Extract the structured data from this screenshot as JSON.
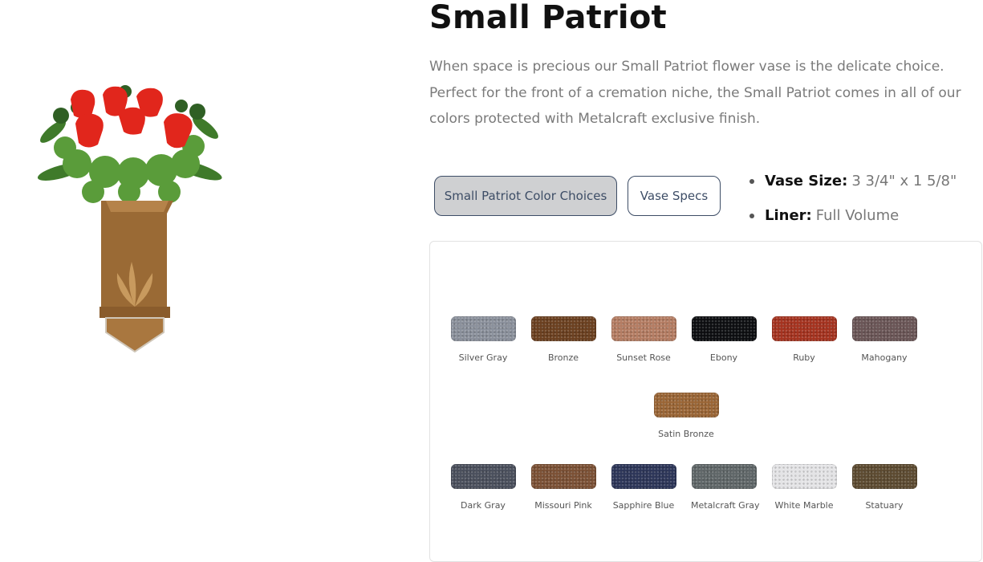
{
  "product": {
    "title": "Small Patriot",
    "description": "When space is precious our Small Patriot flower vase is the delicate choice. Perfect for the front of a cremation niche, the Small Patriot comes in all of our colors protected with Metalcraft exclusive finish.",
    "image_alt": "Small Patriot bronze flower vase with red roses"
  },
  "tabs": [
    {
      "label": "Small Patriot Color Choices",
      "active": true
    },
    {
      "label": "Vase Specs",
      "active": false
    }
  ],
  "specs": [
    {
      "label": "Vase Size:",
      "value": "3 3/4\" x 1 5/8\""
    },
    {
      "label": "Liner:",
      "value": "Full Volume"
    }
  ],
  "colors": {
    "row1": [
      {
        "name": "Silver Gray",
        "color": "#8a909b"
      },
      {
        "name": "Bronze",
        "color": "#6b3f1f"
      },
      {
        "name": "Sunset Rose",
        "color": "#b47c62"
      },
      {
        "name": "Ebony",
        "color": "#0c0d10"
      },
      {
        "name": "Ruby",
        "color": "#a5321e"
      },
      {
        "name": "Mahogany",
        "color": "#6a5556"
      }
    ],
    "row2": [
      {
        "name": "Satin Bronze",
        "color": "#9a6535"
      }
    ],
    "row3": [
      {
        "name": "Dark Gray",
        "color": "#4a4f5c"
      },
      {
        "name": "Missouri Pink",
        "color": "#7b5034"
      },
      {
        "name": "Sapphire Blue",
        "color": "#2c3558"
      },
      {
        "name": "Metalcraft Gray",
        "color": "#5f6668"
      },
      {
        "name": "White Marble",
        "color": "#e4e4e6"
      },
      {
        "name": "Statuary",
        "color": "#5c4a30"
      }
    ]
  }
}
